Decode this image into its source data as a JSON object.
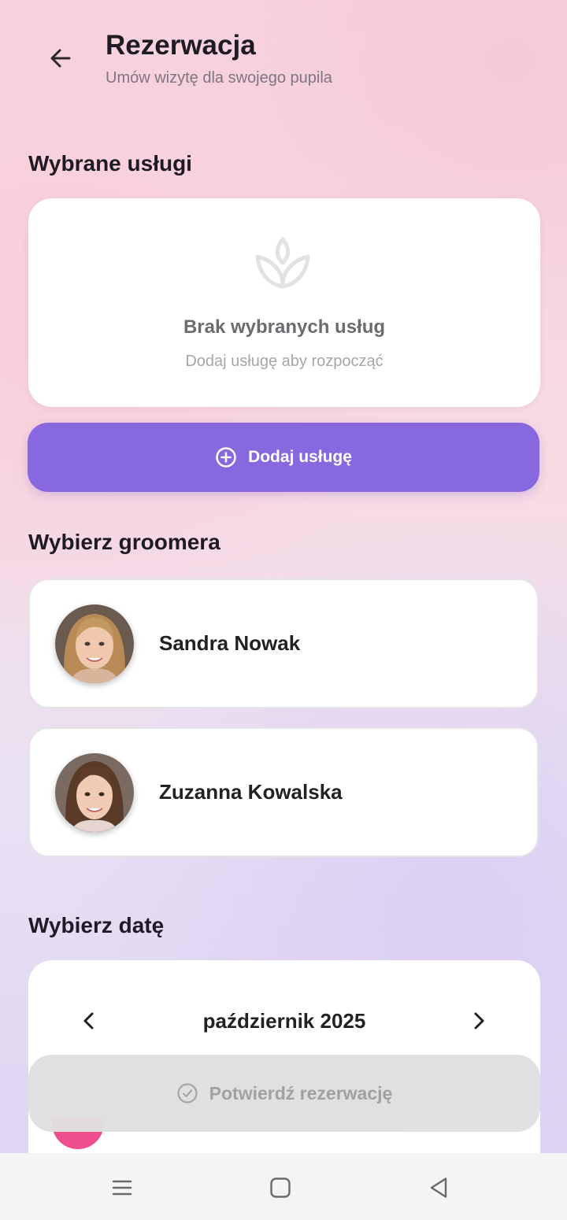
{
  "header": {
    "title": "Rezerwacja",
    "subtitle": "Umów wizytę dla swojego pupila",
    "back_icon": "arrow-left-icon"
  },
  "services": {
    "section_title": "Wybrane usługi",
    "empty_icon": "leaf-icon",
    "empty_title": "Brak wybranych usług",
    "empty_subtitle": "Dodaj usługę aby rozpocząć",
    "add_button_label": "Dodaj usługę",
    "add_button_icon": "plus-circle-icon"
  },
  "groomers": {
    "section_title": "Wybierz groomera",
    "items": [
      {
        "name": "Sandra Nowak"
      },
      {
        "name": "Zuzanna Kowalska"
      }
    ]
  },
  "date": {
    "section_title": "Wybierz datę",
    "month_label": "październik 2025",
    "prev_icon": "chevron-left-icon",
    "next_icon": "chevron-right-icon"
  },
  "confirm": {
    "label": "Potwierdź rezerwację",
    "icon": "check-circle-icon"
  },
  "navbar": {
    "items": [
      "menu-icon",
      "home-icon",
      "back-triangle-icon"
    ]
  },
  "colors": {
    "accent": "#8768df",
    "disabled": "#e0e0e0",
    "pink": "#ee4f8c"
  }
}
